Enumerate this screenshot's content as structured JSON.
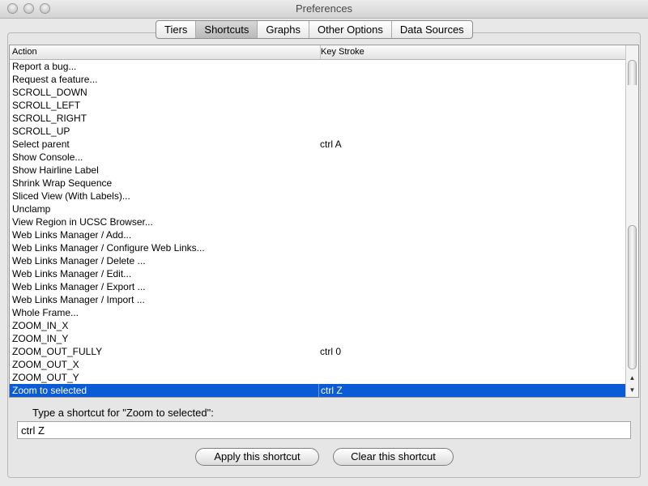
{
  "window": {
    "title": "Preferences"
  },
  "tabs": [
    "Tiers",
    "Shortcuts",
    "Graphs",
    "Other Options",
    "Data Sources"
  ],
  "table": {
    "columns": [
      "Action",
      "Key Stroke"
    ],
    "rows": [
      [
        "Report a bug...",
        ""
      ],
      [
        "Request a feature...",
        ""
      ],
      [
        "SCROLL_DOWN",
        ""
      ],
      [
        "SCROLL_LEFT",
        ""
      ],
      [
        "SCROLL_RIGHT",
        ""
      ],
      [
        "SCROLL_UP",
        ""
      ],
      [
        "Select parent",
        "ctrl A"
      ],
      [
        "Show Console...",
        ""
      ],
      [
        "Show Hairline Label",
        ""
      ],
      [
        "Shrink Wrap Sequence",
        ""
      ],
      [
        "Sliced View (With Labels)...",
        ""
      ],
      [
        "Unclamp",
        ""
      ],
      [
        "View Region in UCSC Browser...",
        ""
      ],
      [
        "Web Links Manager / Add...",
        ""
      ],
      [
        "Web Links Manager / Configure Web Links...",
        ""
      ],
      [
        "Web Links Manager / Delete ...",
        ""
      ],
      [
        "Web Links Manager / Edit...",
        ""
      ],
      [
        "Web Links Manager / Export ...",
        ""
      ],
      [
        "Web Links Manager / Import ...",
        ""
      ],
      [
        "Whole Frame...",
        ""
      ],
      [
        "ZOOM_IN_X",
        ""
      ],
      [
        "ZOOM_IN_Y",
        ""
      ],
      [
        "ZOOM_OUT_FULLY",
        "ctrl 0"
      ],
      [
        "ZOOM_OUT_X",
        ""
      ],
      [
        "ZOOM_OUT_Y",
        ""
      ],
      [
        "Zoom to selected",
        "ctrl Z"
      ]
    ]
  },
  "shortcut": {
    "prompt": "Type a shortcut for \"Zoom to selected\":",
    "value": "ctrl Z"
  },
  "buttons": {
    "apply": "Apply this shortcut",
    "clear": "Clear this shortcut"
  }
}
